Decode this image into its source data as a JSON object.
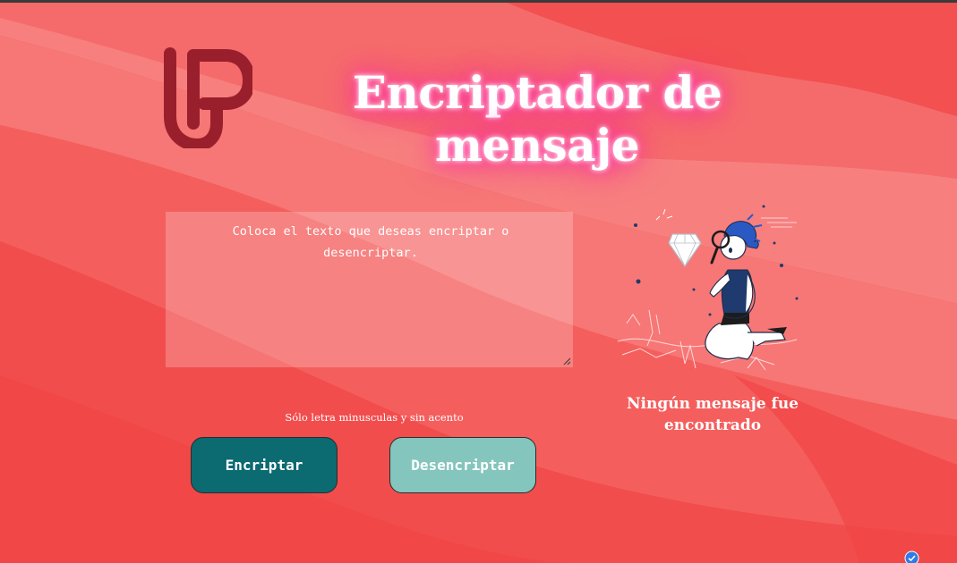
{
  "header": {
    "title": "Encriptador de mensaje",
    "logo_icon": "tp-logo-icon"
  },
  "input": {
    "placeholder": "Coloca el texto que deseas encriptar o desencriptar."
  },
  "hint": "Sólo letra minusculas y sin acento",
  "buttons": {
    "encrypt_label": "Encriptar",
    "decrypt_label": "Desencriptar"
  },
  "output": {
    "illustration_icon": "person-magnifying-glass-icon",
    "empty_message": "Ningún mensaje fue encontrado"
  },
  "colors": {
    "background": "#f34a4b",
    "encrypt_button": "#0c6a71",
    "decrypt_button": "#84c5bd",
    "logo": "#9a1f2c",
    "title_glow": "#ff2f9a"
  }
}
